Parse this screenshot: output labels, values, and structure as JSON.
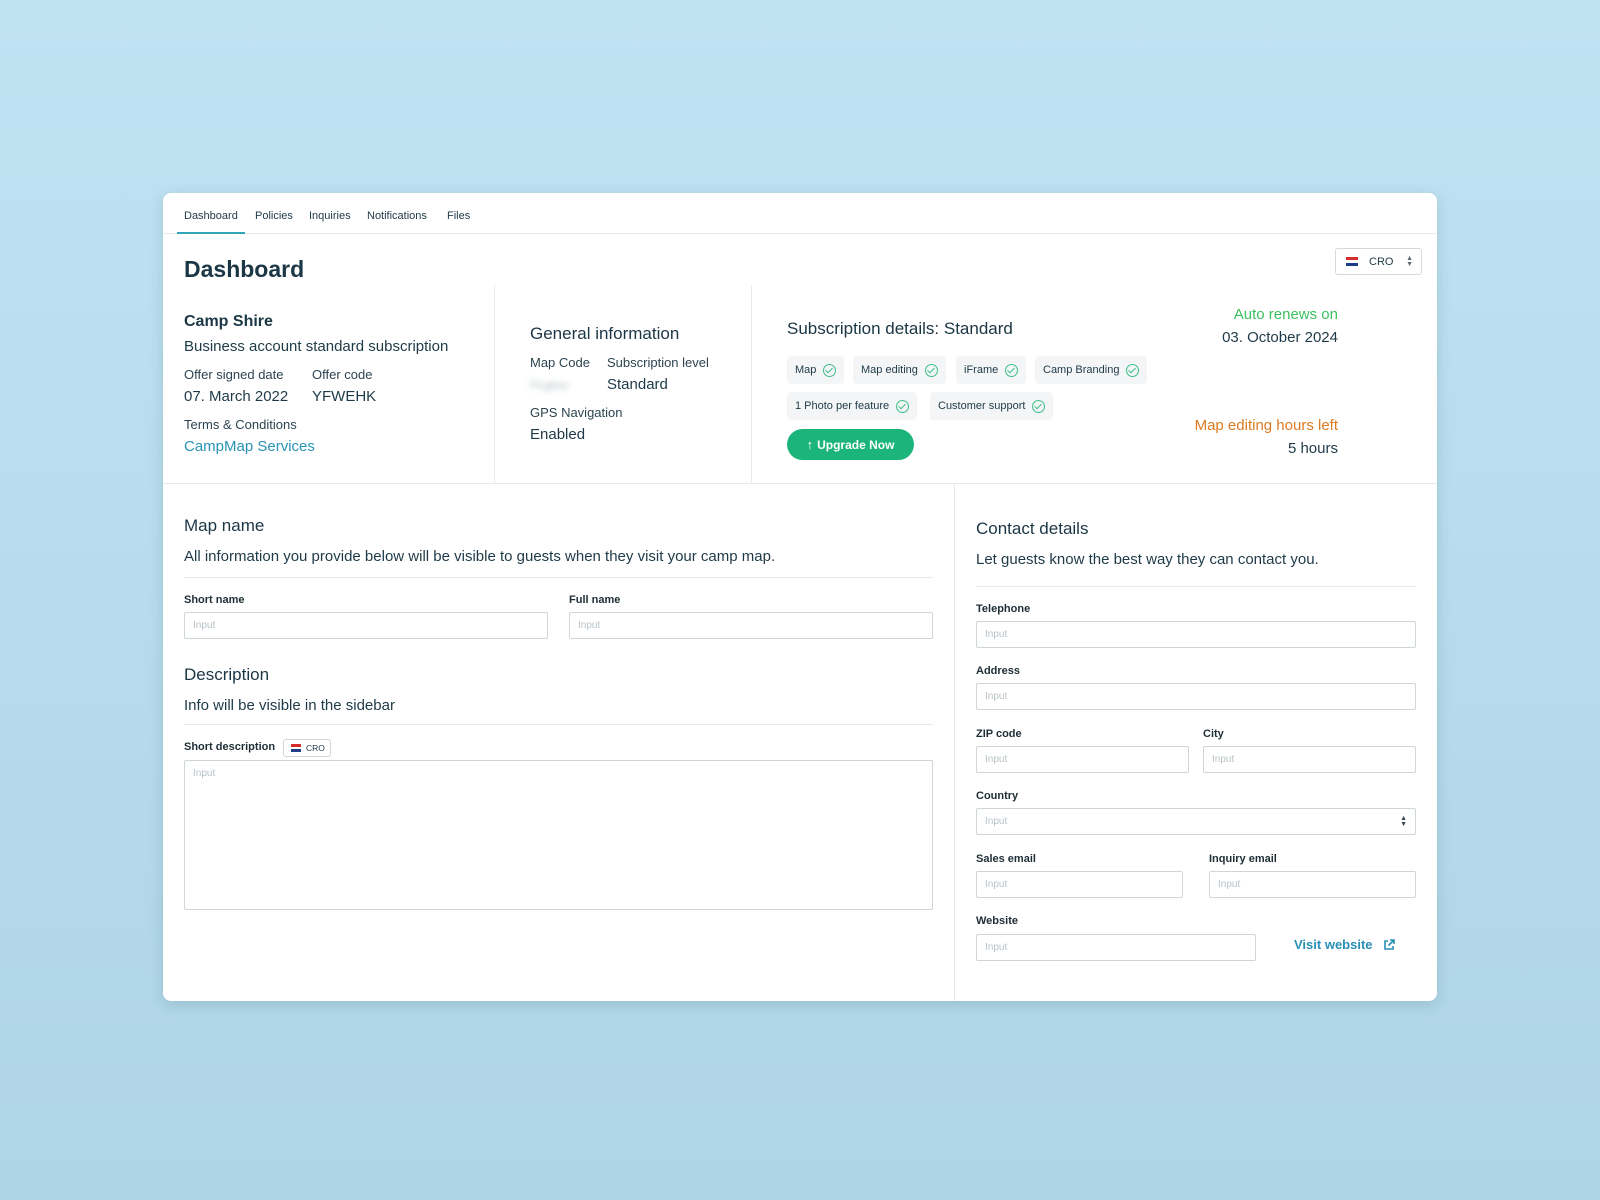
{
  "tabs": [
    "Dashboard",
    "Policies",
    "Inquiries",
    "Notifications",
    "Files"
  ],
  "page_title": "Dashboard",
  "language_select": {
    "value": "CRO"
  },
  "account": {
    "name": "Camp Shire",
    "type": "Business account standard subscription",
    "offer_signed_label": "Offer signed date",
    "offer_signed_value": "07. March 2022",
    "offer_code_label": "Offer code",
    "offer_code_value": "YFWEHK",
    "terms_label": "Terms & Conditions",
    "terms_link": "CampMap Services"
  },
  "general": {
    "title": "General information",
    "map_code_label": "Map Code",
    "map_code_value": "Pcgbsc",
    "subscription_level_label": "Subscription level",
    "subscription_level_value": "Standard",
    "gps_label": "GPS Navigation",
    "gps_value": "Enabled"
  },
  "subscription": {
    "title": "Subscription details: Standard",
    "features": [
      "Map",
      "Map editing",
      "iFrame",
      "Camp Branding",
      "1 Photo per feature",
      "Customer support"
    ],
    "upgrade_label": "Upgrade Now",
    "auto_renew_label": "Auto renews on",
    "auto_renew_value": "03. October 2024",
    "hours_left_label": "Map editing hours left",
    "hours_left_value": "5 hours"
  },
  "map_section": {
    "title": "Map name",
    "subtitle": "All information you provide below will be visible to guests when they visit your camp map.",
    "short_name_label": "Short name",
    "full_name_label": "Full name",
    "placeholder": "Input"
  },
  "description_section": {
    "title": "Description",
    "subtitle": "Info will be visible in the sidebar",
    "short_description_label": "Short description",
    "lang_badge": "CRO",
    "placeholder": "Input"
  },
  "contact": {
    "title": "Contact details",
    "subtitle": "Let guests know the best way they can contact you.",
    "telephone_label": "Telephone",
    "address_label": "Address",
    "zip_label": "ZIP code",
    "city_label": "City",
    "country_label": "Country",
    "sales_email_label": "Sales email",
    "inquiry_email_label": "Inquiry email",
    "website_label": "Website",
    "visit_website_label": "Visit website",
    "placeholder": "Input"
  },
  "colors": {
    "accent_teal": "#2fa7b9",
    "upgrade_green": "#1bb57c",
    "renew_green": "#3cbf5e",
    "hours_orange": "#dd7a22",
    "link_blue": "#2a93b7"
  }
}
